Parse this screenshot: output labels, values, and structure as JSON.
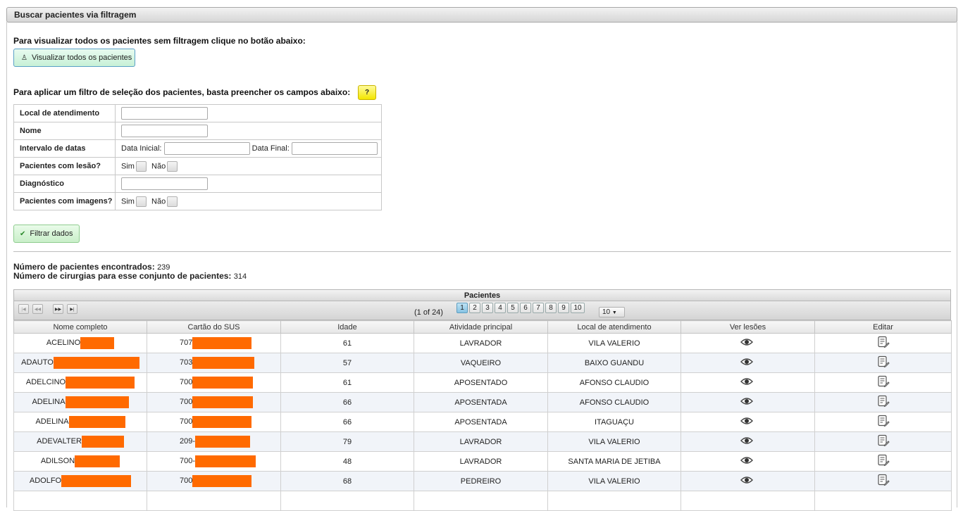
{
  "panel": {
    "title": "Buscar pacientes via filtragem"
  },
  "view_all": {
    "text": "Para visualizar todos os pacientes sem filtragem clique no botão abaixo:",
    "button_label": "Visualizar todos os pacientes",
    "button_icon": "person-icon"
  },
  "filter": {
    "text": "Para aplicar um filtro de seleção dos pacientes, basta preencher os campos abaixo:",
    "help_label": "?",
    "rows": {
      "local": {
        "label": "Local de atendimento",
        "value": ""
      },
      "nome": {
        "label": "Nome",
        "value": ""
      },
      "datas": {
        "label": "Intervalo de datas",
        "start_label": "Data Inicial:",
        "end_label": "Data Final:"
      },
      "lesao": {
        "label": "Pacientes com lesão?",
        "yes": "Sim",
        "no": "Não"
      },
      "diagnostico": {
        "label": "Diagnóstico",
        "value": ""
      },
      "imagens": {
        "label": "Pacientes com imagens?",
        "yes": "Sim",
        "no": "Não"
      }
    },
    "button_label": "Filtrar dados",
    "button_icon": "check-icon"
  },
  "counts": {
    "patients_label": "Número de pacientes encontrados:",
    "patients_value": "239",
    "surgeries_label": "Número de cirurgias para esse conjunto de pacientes:",
    "surgeries_value": "314"
  },
  "grid": {
    "title": "Pacientes",
    "pager": {
      "info": "(1 of 24)",
      "pages": [
        "1",
        "2",
        "3",
        "4",
        "5",
        "6",
        "7",
        "8",
        "9",
        "10"
      ],
      "current_page": "1",
      "rows_per_page": "10"
    },
    "columns": [
      "Nome completo",
      "Cartão do SUS",
      "Idade",
      "Atividade principal",
      "Local de atendimento",
      "Ver lesões",
      "Editar"
    ],
    "rows": [
      {
        "name": "ACELINO",
        "sus": "707",
        "age": "61",
        "job": "LAVRADOR",
        "place": "VILA VALERIO"
      },
      {
        "name": "ADAUTO",
        "sus": "703",
        "age": "57",
        "job": "VAQUEIRO",
        "place": "BAIXO GUANDU"
      },
      {
        "name": "ADELCINO",
        "sus": "700",
        "age": "61",
        "job": "APOSENTADO",
        "place": "AFONSO CLAUDIO"
      },
      {
        "name": "ADELINA",
        "sus": "700",
        "age": "66",
        "job": "APOSENTADA",
        "place": "AFONSO CLAUDIO"
      },
      {
        "name": "ADELINA",
        "sus": "700",
        "age": "66",
        "job": "APOSENTADA",
        "place": "ITAGUAÇU"
      },
      {
        "name": "ADEVALTER",
        "sus": "209-",
        "age": "79",
        "job": "LAVRADOR",
        "place": "VILA VALERIO"
      },
      {
        "name": "ADILSON",
        "sus": "700-",
        "age": "48",
        "job": "LAVRADOR",
        "place": "SANTA MARIA DE JETIBA"
      },
      {
        "name": "ADOLFO",
        "sus": "700",
        "age": "68",
        "job": "PEDREIRO",
        "place": "VILA VALERIO"
      }
    ],
    "view_icon": "eye-icon",
    "edit_icon": "edit-note-icon",
    "redaction_color": "#ff6a00"
  }
}
